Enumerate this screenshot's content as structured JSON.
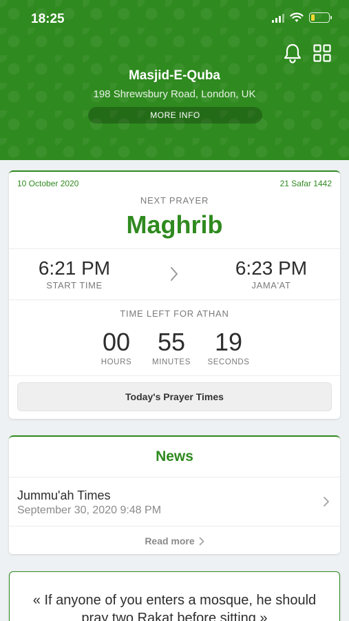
{
  "status_bar": {
    "time": "18:25"
  },
  "header": {
    "mosque_name": "Masjid-E-Quba",
    "address": "198 Shrewsbury Road, London, UK",
    "more_info_label": "MORE INFO",
    "icons": [
      "bell-icon",
      "grid-icon"
    ]
  },
  "prayer": {
    "gregorian_date": "10 October 2020",
    "hijri_date": "21 Safar 1442",
    "next_label": "NEXT PRAYER",
    "next_name": "Maghrib",
    "start_time": "6:21 PM",
    "start_label": "START TIME",
    "jamaat_time": "6:23 PM",
    "jamaat_label": "JAMA'AT",
    "time_left_label": "TIME LEFT FOR ATHAN",
    "hours": "00",
    "hours_label": "HOURS",
    "minutes": "55",
    "minutes_label": "MINUTES",
    "seconds": "19",
    "seconds_label": "SECONDS",
    "todays_button": "Today's Prayer Times"
  },
  "news": {
    "title": "News",
    "items": [
      {
        "title": "Jummu'ah Times",
        "date": "September 30, 2020 9:48 PM"
      }
    ],
    "read_more": "Read more"
  },
  "quote": {
    "text": "« If anyone of you enters a mosque, he should pray two Rakat before sitting »"
  },
  "colors": {
    "brand": "#2f8a1f",
    "background": "#eef1f3",
    "battery": "#f1d733"
  }
}
